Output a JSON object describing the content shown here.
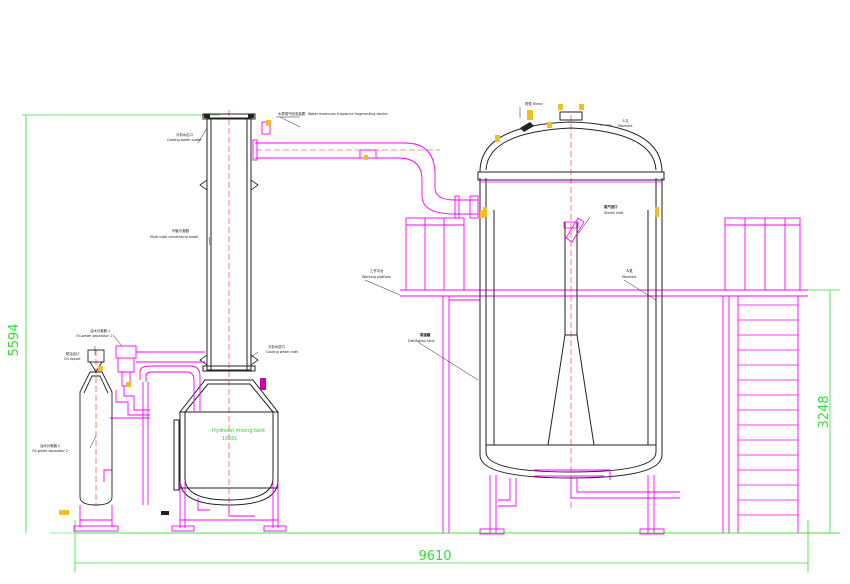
{
  "dimensions": {
    "total_width": "9610",
    "total_height": "5594",
    "platform_height": "3248"
  },
  "labels": {
    "cooling_outlet": "冷却水出口",
    "cooling_outlet_en": "Cooling water outlet",
    "fragrance_device": "水雾香气回收装置",
    "fragrance_device_en": "Water molecular fragrance fragmenting device",
    "vent_top": "视镜 Mirror",
    "manhole": "人孔",
    "manhole_en": "Manhole",
    "tubular_condenser": "列管冷凝器",
    "tubular_condenser_en": "Multi-tube condensing water",
    "working_platform": "工作平台",
    "working_platform_en": "Working platform",
    "oil_water_sep_top": "油水分离器 1",
    "oil_water_sep_top_en": "Oil-water separator 1",
    "oil_export": "精油出口",
    "oil_export_en": "Oil export",
    "cooling_inlet": "冷却水进口",
    "cooling_inlet_en": "Cooling water inlet",
    "distillation_tank": "蒸馏罐",
    "distillation_tank_en": "Distillation tank",
    "steam_inlet": "蒸汽进口",
    "steam_inlet_en": "Steam inlet",
    "hydrosol_tank": "Hydrosol mixing tank",
    "hydrosol_volume": "1000L",
    "oil_water_sep_bottom": "油水分离器 2",
    "oil_water_sep_bottom_en": "Oil-water separator 2"
  },
  "colors": {
    "magenta": "#ff00ff",
    "red_centerline": "#ff2020",
    "dim_green": "#33dd33",
    "vessel_line": "#222222",
    "gold_fitting": "#f0c020"
  }
}
